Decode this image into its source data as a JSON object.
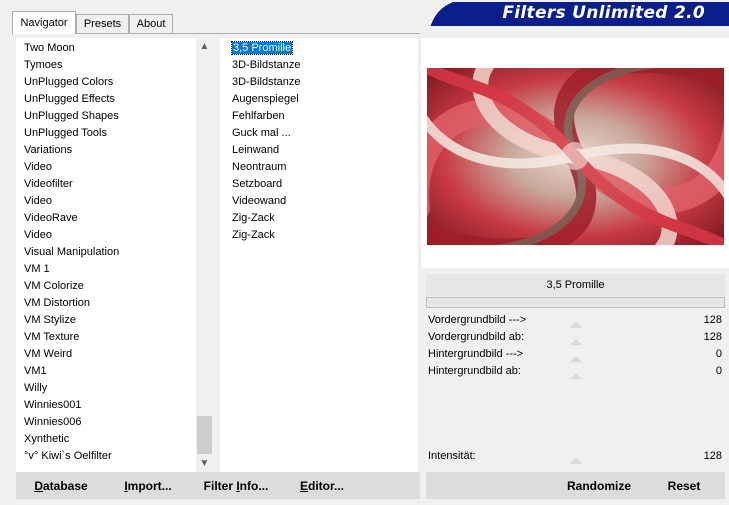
{
  "tabs": [
    {
      "label": "Navigator"
    },
    {
      "label": "Presets"
    },
    {
      "label": "About"
    }
  ],
  "banner": {
    "title": "Filters Unlimited 2.0"
  },
  "categories": [
    "Two Moon",
    "Tymoes",
    "UnPlugged Colors",
    "UnPlugged Effects",
    "UnPlugged Shapes",
    "UnPlugged Tools",
    "Variations",
    "Video",
    "Videofilter",
    "Video",
    "VideoRave",
    "Video",
    "Visual Manipulation",
    "VM 1",
    "VM Colorize",
    "VM Distortion",
    "VM Stylize",
    "VM Texture",
    "VM Weird",
    "VM1",
    "Willy",
    "Winnies001",
    "Winnies006",
    "Xynthetic",
    "°v° Kiwi`s Oelfilter"
  ],
  "filters": [
    "3,5 Promille",
    "3D-Bildstanze",
    "3D-Bildstanze",
    "Augenspiegel",
    "Fehlfarben",
    "Guck mal ...",
    "Leinwand",
    "Neontraum",
    "Setzboard",
    "Videowand",
    "Zig-Zack",
    "Zig-Zack"
  ],
  "selected_filter": "3,5 Promille",
  "filter_title": "3,5 Promille",
  "params": [
    {
      "label": "Vordergrundbild --->",
      "value": "128"
    },
    {
      "label": "Vordergrundbild ab:",
      "value": "128"
    },
    {
      "label": "Hintergrundbild --->",
      "value": "0"
    },
    {
      "label": "Hintergrundbild ab:",
      "value": "0"
    },
    {
      "label": "Intensität:",
      "value": "128"
    }
  ],
  "buttons": {
    "database": {
      "pre": "",
      "key": "D",
      "post": "atabase"
    },
    "import": {
      "pre": "",
      "key": "I",
      "post": "mport..."
    },
    "filter_info": {
      "pre": "Filter ",
      "key": "I",
      "post": "nfo..."
    },
    "editor": {
      "pre": "",
      "key": "E",
      "post": "ditor..."
    },
    "randomize": "Randomize",
    "reset": "Reset"
  },
  "colors": {
    "banner_blue": "#0a1e8c",
    "selection": "#0078d7"
  }
}
